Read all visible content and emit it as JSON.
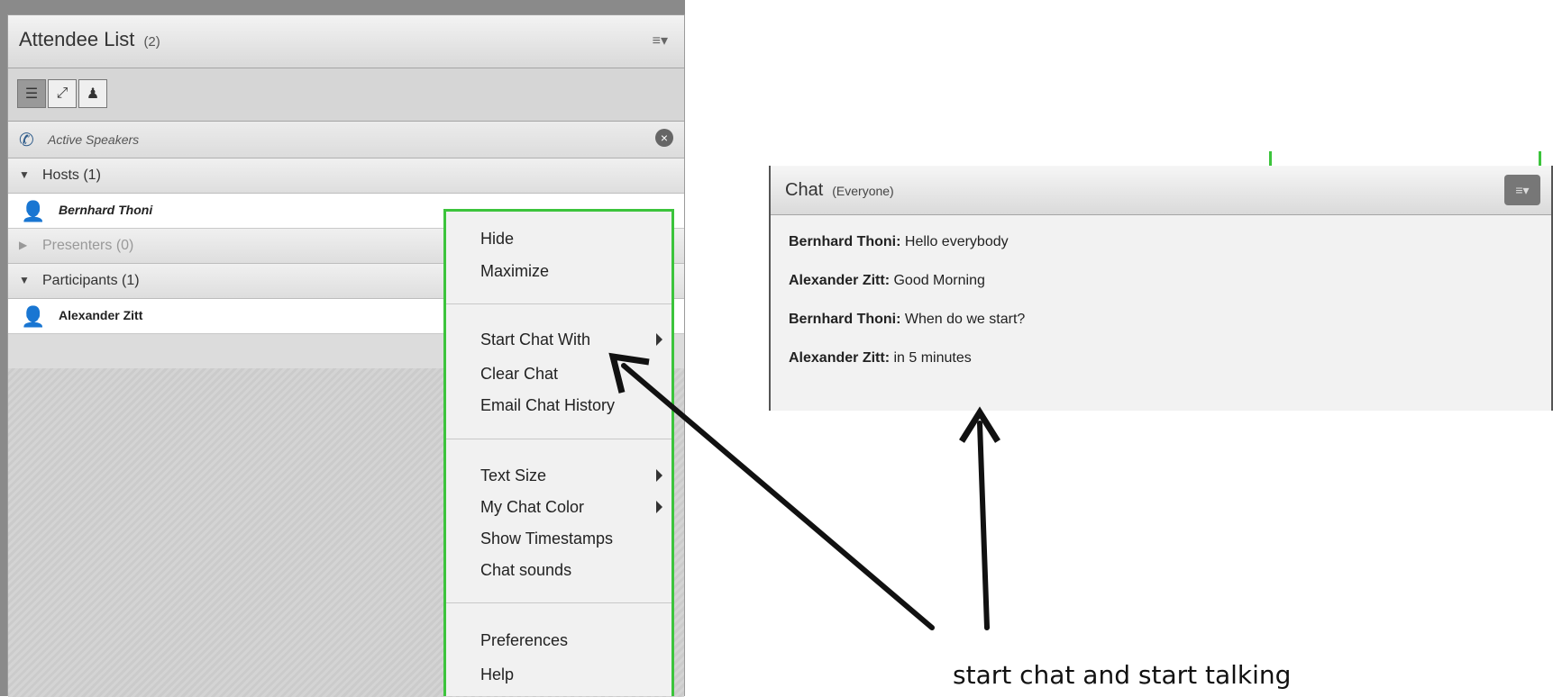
{
  "attendee_list": {
    "title": "Attendee List",
    "count": "(2)",
    "menu_icon": "pod-options-icon",
    "active_speakers_label": "Active Speakers",
    "groups": [
      {
        "label": "Hosts (1)",
        "expanded": true
      },
      {
        "label": "Presenters (0)",
        "expanded": false
      },
      {
        "label": "Participants (1)",
        "expanded": true
      }
    ],
    "hosts": [
      {
        "name": "Bernhard Thoni"
      }
    ],
    "participants": [
      {
        "name": "Alexander Zitt"
      }
    ]
  },
  "context_menu": {
    "items": [
      {
        "label": "Hide",
        "submenu": false
      },
      {
        "label": "Maximize",
        "submenu": false
      },
      {
        "label": "Start Chat With",
        "submenu": true
      },
      {
        "label": "Clear Chat",
        "submenu": false
      },
      {
        "label": "Email Chat History",
        "submenu": false
      },
      {
        "label": "Text Size",
        "submenu": true
      },
      {
        "label": "My Chat Color",
        "submenu": true
      },
      {
        "label": "Show Timestamps",
        "submenu": false
      },
      {
        "label": "Chat sounds",
        "submenu": false
      },
      {
        "label": "Preferences",
        "submenu": false
      },
      {
        "label": "Help",
        "submenu": false
      }
    ]
  },
  "chat": {
    "title": "Chat",
    "scope": "(Everyone)",
    "messages": [
      {
        "sender": "Bernhard Thoni:",
        "text": "Hello everybody"
      },
      {
        "sender": "Alexander Zitt:",
        "text": "Good Morning"
      },
      {
        "sender": "Bernhard Thoni:",
        "text": "When do we start?"
      },
      {
        "sender": "Alexander Zitt:",
        "text": "in 5 minutes"
      }
    ]
  },
  "annotation": {
    "caption": "start chat and start talking"
  },
  "colors": {
    "highlight_green": "#3cc43c",
    "panel_gray": "#dcdcdc"
  }
}
